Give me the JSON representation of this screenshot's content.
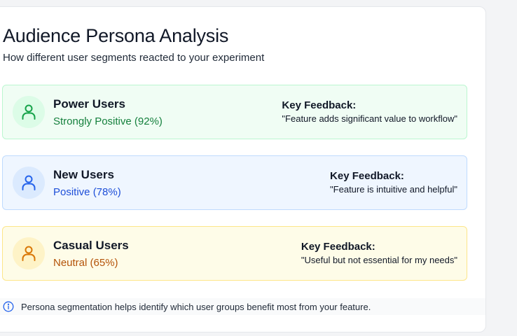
{
  "header": {
    "title": "Audience Persona Analysis",
    "subtitle": "How different user segments reacted to your experiment"
  },
  "personas": [
    {
      "name": "Power Users",
      "sentiment": "Strongly Positive (92%)",
      "feedback_label": "Key Feedback:",
      "feedback": "\"Feature adds significant value to workflow\"",
      "color": "#16a34a",
      "icon": "user-icon"
    },
    {
      "name": "New Users",
      "sentiment": "Positive (78%)",
      "feedback_label": "Key Feedback:",
      "feedback": "\"Feature is intuitive and helpful\"",
      "color": "#2563eb",
      "icon": "user-icon"
    },
    {
      "name": "Casual Users",
      "sentiment": "Neutral (65%)",
      "feedback_label": "Key Feedback:",
      "feedback": "\"Useful but not essential for my needs\"",
      "color": "#d97706",
      "icon": "user-icon"
    }
  ],
  "footer": {
    "icon": "info-icon",
    "text": "Persona segmentation helps identify which user groups benefit most from your feature.",
    "color": "#2563eb"
  }
}
